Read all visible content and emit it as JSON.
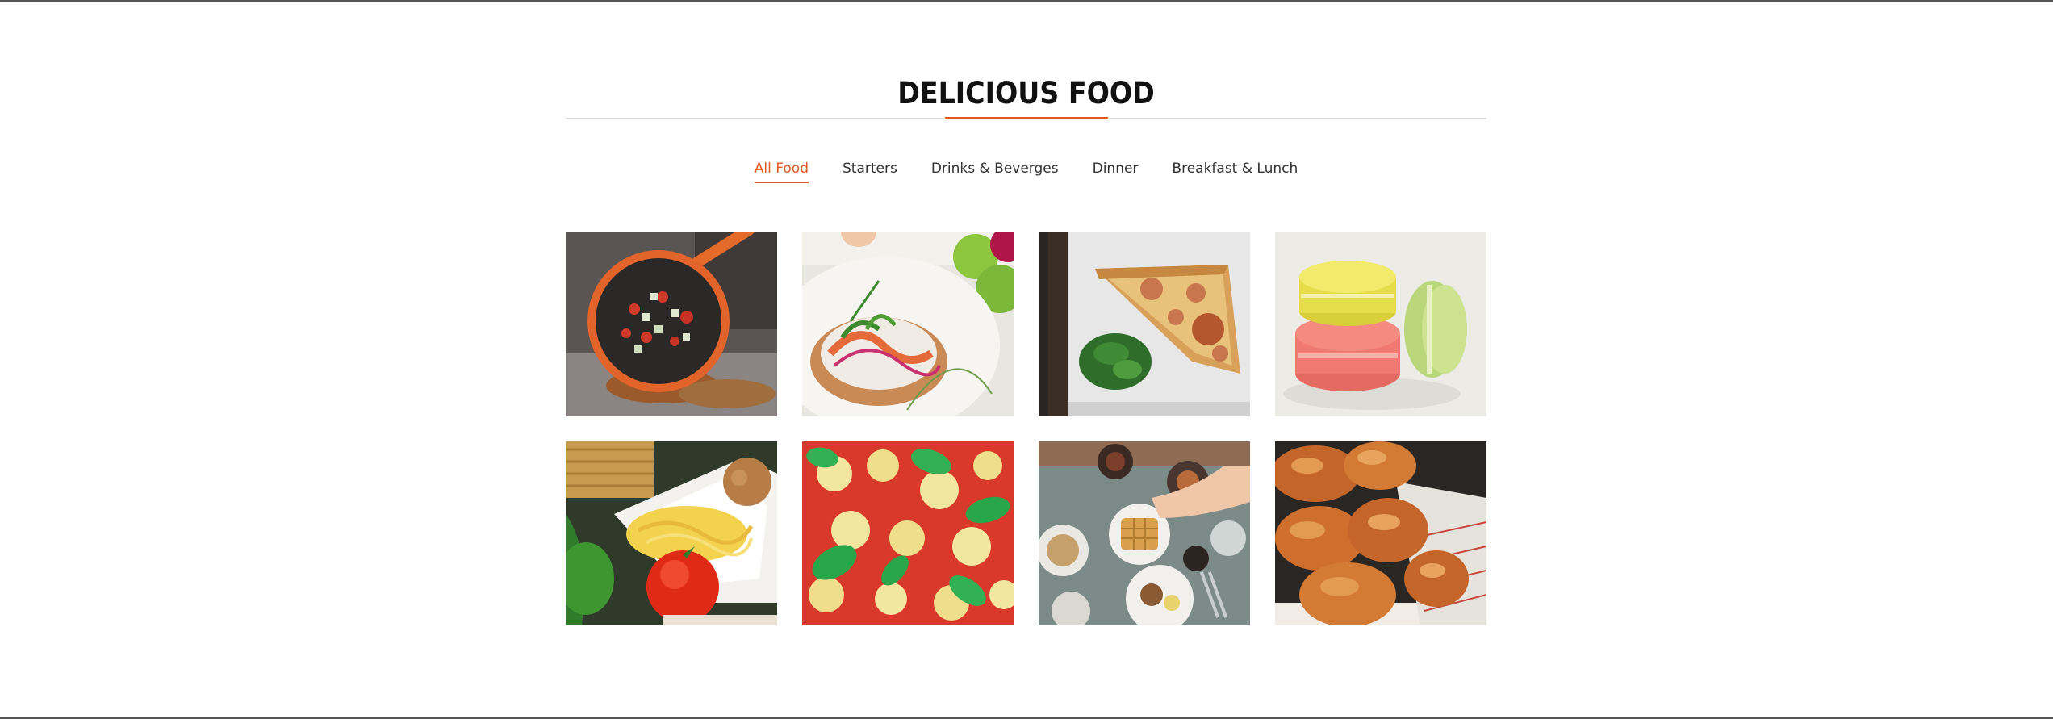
{
  "section": {
    "title": "DELICIOUS FOOD"
  },
  "tabs": [
    {
      "label": "All Food",
      "active": true
    },
    {
      "label": "Starters",
      "active": false
    },
    {
      "label": "Drinks & Beverges",
      "active": false
    },
    {
      "label": "Dinner",
      "active": false
    },
    {
      "label": "Breakfast & Lunch",
      "active": false
    }
  ],
  "colors": {
    "accent": "#e0591f",
    "text": "#333333",
    "rule": "#d8d8d8"
  },
  "gallery": [
    {
      "name": "pan-vegetables-photo"
    },
    {
      "name": "salad-plate-photo"
    },
    {
      "name": "pizza-slice-photo"
    },
    {
      "name": "macarons-photo"
    },
    {
      "name": "noodles-tomato-photo"
    },
    {
      "name": "basil-pizza-photo"
    },
    {
      "name": "breakfast-table-photo"
    },
    {
      "name": "fried-chicken-photo"
    }
  ]
}
